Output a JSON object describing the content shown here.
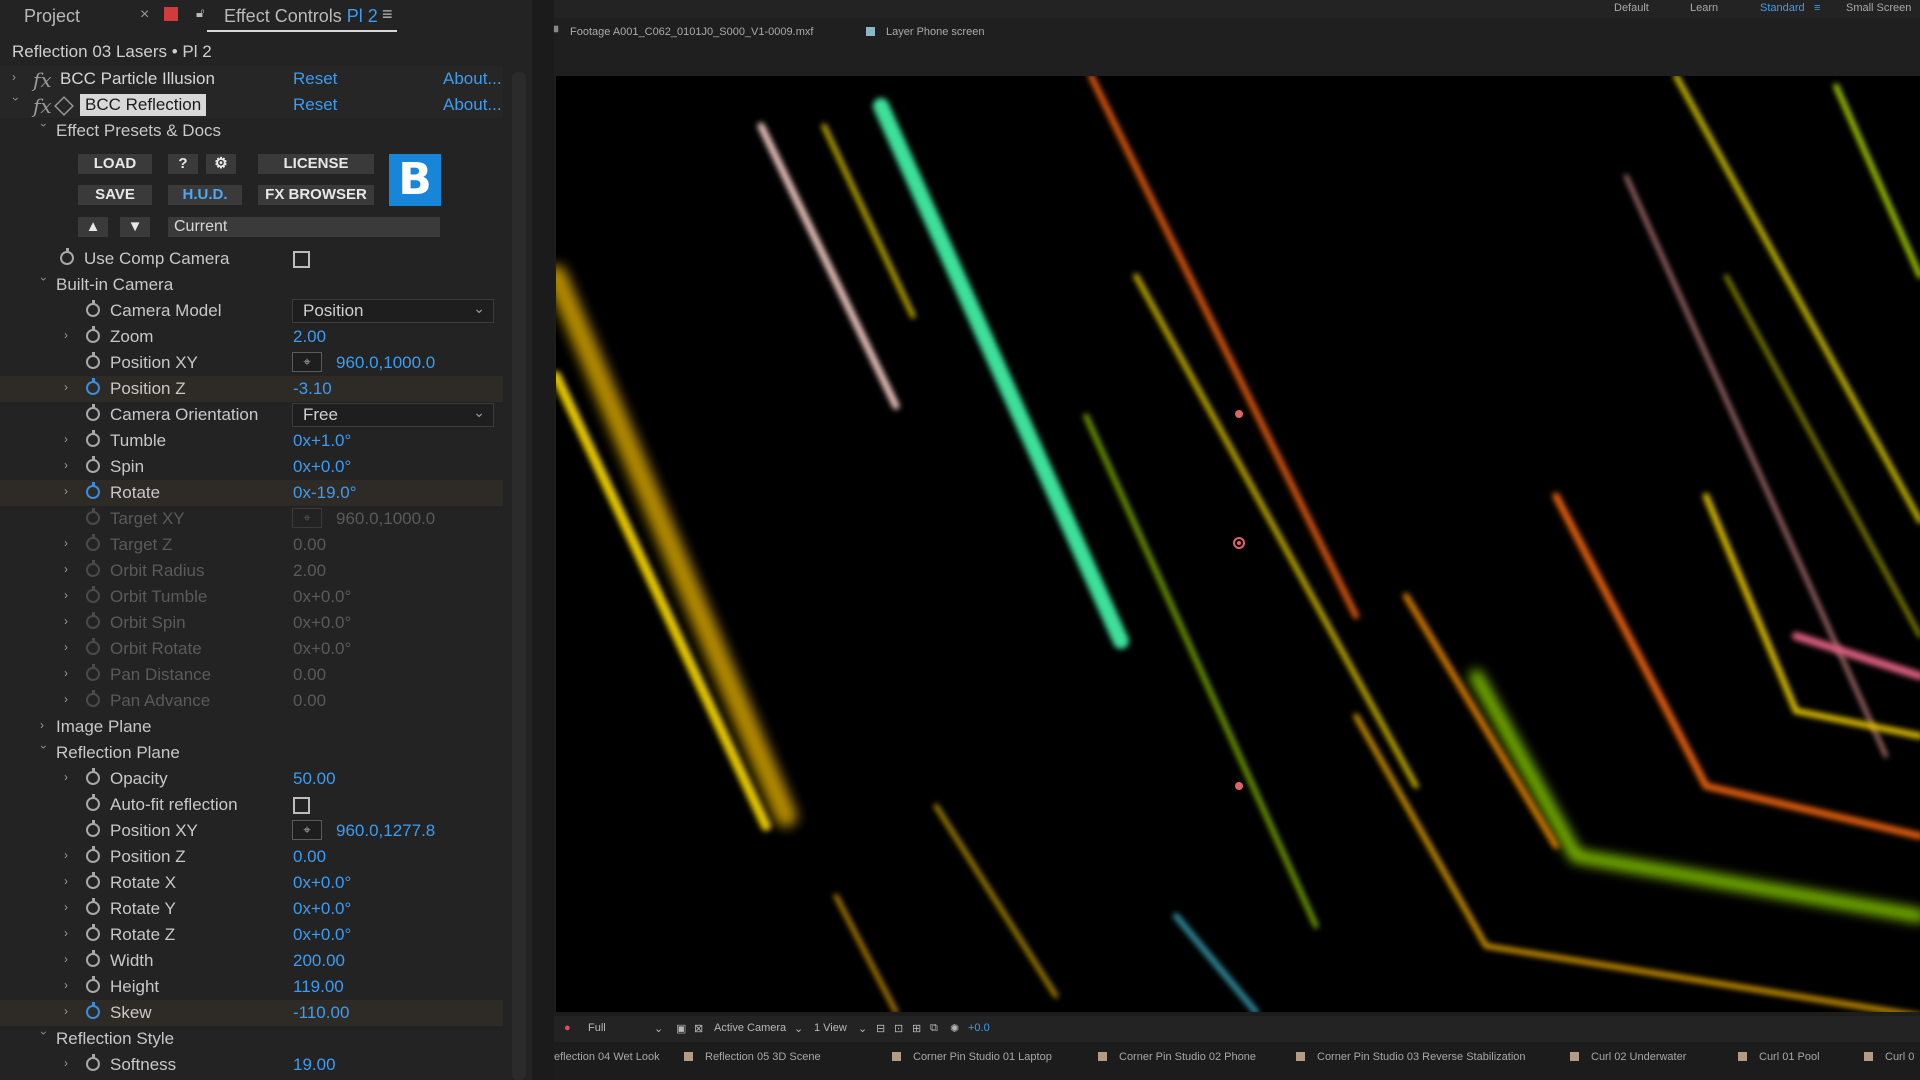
{
  "panel_tabs": {
    "project": "Project",
    "effect_controls": "Effect Controls",
    "effect_controls_target": "Pl 2"
  },
  "comp_title": "Reflection 03 Lasers • Pl 2",
  "effects": [
    {
      "name": "BCC Particle Illusion",
      "reset": "Reset",
      "about": "About..."
    },
    {
      "name": "BCC Reflection",
      "reset": "Reset",
      "about": "About..."
    }
  ],
  "presets": {
    "group": "Effect Presets & Docs",
    "load": "LOAD",
    "help": "?",
    "license": "LICENSE",
    "save": "SAVE",
    "hud": "H.U.D.",
    "fx_browser": "FX BROWSER",
    "current": "Current",
    "logo": "B"
  },
  "props": {
    "use_comp_camera": "Use Comp Camera",
    "builtin_camera": "Built-in Camera",
    "camera_model": {
      "label": "Camera Model",
      "value": "Position"
    },
    "zoom": {
      "label": "Zoom",
      "value": "2.00"
    },
    "position_xy": {
      "label": "Position XY",
      "value": "960.0,1000.0"
    },
    "position_z": {
      "label": "Position Z",
      "value": "-3.10"
    },
    "camera_orientation": {
      "label": "Camera Orientation",
      "value": "Free"
    },
    "tumble": {
      "label": "Tumble",
      "value": "0x+1.0°"
    },
    "spin": {
      "label": "Spin",
      "value": "0x+0.0°"
    },
    "rotate": {
      "label": "Rotate",
      "value": "0x-19.0°"
    },
    "target_xy": {
      "label": "Target XY",
      "value": "960.0,1000.0"
    },
    "target_z": {
      "label": "Target Z",
      "value": "0.00"
    },
    "orbit_radius": {
      "label": "Orbit Radius",
      "value": "2.00"
    },
    "orbit_tumble": {
      "label": "Orbit Tumble",
      "value": "0x+0.0°"
    },
    "orbit_spin": {
      "label": "Orbit Spin",
      "value": "0x+0.0°"
    },
    "orbit_rotate": {
      "label": "Orbit Rotate",
      "value": "0x+0.0°"
    },
    "pan_distance": {
      "label": "Pan Distance",
      "value": "0.00"
    },
    "pan_advance": {
      "label": "Pan Advance",
      "value": "0.00"
    },
    "image_plane": "Image Plane",
    "reflection_plane": "Reflection Plane",
    "opacity": {
      "label": "Opacity",
      "value": "50.00"
    },
    "auto_fit": {
      "label": "Auto-fit reflection"
    },
    "rp_position_xy": {
      "label": "Position XY",
      "value": "960.0,1277.8"
    },
    "rp_position_z": {
      "label": "Position Z",
      "value": "0.00"
    },
    "rotate_x": {
      "label": "Rotate X",
      "value": "0x+0.0°"
    },
    "rotate_y": {
      "label": "Rotate Y",
      "value": "0x+0.0°"
    },
    "rotate_z": {
      "label": "Rotate Z",
      "value": "0x+0.0°"
    },
    "width": {
      "label": "Width",
      "value": "200.00"
    },
    "height": {
      "label": "Height",
      "value": "119.00"
    },
    "skew": {
      "label": "Skew",
      "value": "-110.00"
    },
    "reflection_style": "Reflection Style",
    "softness": {
      "label": "Softness",
      "value": "19.00"
    }
  },
  "workspaces": [
    "Default",
    "Learn",
    "Standard",
    "Small Screen"
  ],
  "viewer": {
    "footage_tab": "Footage A001_C062_0101J0_S000_V1-0009.mxf",
    "layer_tab": "Layer Phone screen",
    "resolution": "Full",
    "camera": "Active Camera",
    "views": "1 View",
    "exposure": "+0.0"
  },
  "comp_tabs": [
    "eflection 04 Wet Look",
    "Reflection 05 3D Scene",
    "Corner Pin Studio 01 Laptop",
    "Corner Pin Studio 02 Phone",
    "Corner Pin Studio 03 Reverse Stabilization",
    "Curl 02 Underwater",
    "Curl 01 Pool",
    "Curl 0"
  ],
  "colors": {
    "accent_blue": "#3d9cf0",
    "panel_bg": "#232323",
    "logo_blue": "#1785d8"
  }
}
